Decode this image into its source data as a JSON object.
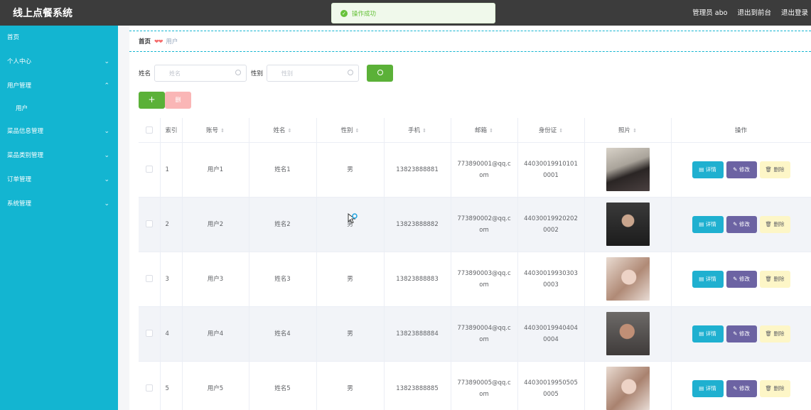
{
  "app": {
    "title": "线上点餐系统"
  },
  "toast": {
    "message": "操作成功"
  },
  "header": {
    "admin_label": "管理员 abo",
    "to_front": "退出到前台",
    "logout": "退出登录"
  },
  "sidebar": {
    "items": [
      {
        "label": "首页"
      },
      {
        "label": "个人中心"
      },
      {
        "label": "用户管理"
      },
      {
        "label": "菜品信息管理"
      },
      {
        "label": "菜品类别管理"
      },
      {
        "label": "订单管理"
      },
      {
        "label": "系统管理"
      }
    ],
    "sub_user": "用户"
  },
  "breadcrumb": {
    "home": "首页",
    "separator": "❤❤",
    "current": "用户"
  },
  "search": {
    "name_label": "姓名",
    "name_placeholder": "姓名",
    "gender_label": "性别",
    "gender_placeholder": "性别"
  },
  "actions": {
    "add": "+",
    "delete": "删"
  },
  "table": {
    "columns": [
      "",
      "索引",
      "账号",
      "姓名",
      "性别",
      "手机",
      "邮箱",
      "身份证",
      "照片",
      "操作"
    ],
    "rows": [
      {
        "index": "1",
        "account": "用户1",
        "name": "姓名1",
        "gender": "男",
        "phone": "13823888881",
        "email": "773890001@qq.com",
        "id_card": "440300199101010001"
      },
      {
        "index": "2",
        "account": "用户2",
        "name": "姓名2",
        "gender": "男",
        "phone": "13823888882",
        "email": "773890002@qq.com",
        "id_card": "440300199202020002"
      },
      {
        "index": "3",
        "account": "用户3",
        "name": "姓名3",
        "gender": "男",
        "phone": "13823888883",
        "email": "773890003@qq.com",
        "id_card": "440300199303030003"
      },
      {
        "index": "4",
        "account": "用户4",
        "name": "姓名4",
        "gender": "男",
        "phone": "13823888884",
        "email": "773890004@qq.com",
        "id_card": "440300199404040004"
      },
      {
        "index": "5",
        "account": "用户5",
        "name": "姓名5",
        "gender": "男",
        "phone": "13823888885",
        "email": "773890005@qq.com",
        "id_card": "440300199505050005"
      }
    ],
    "op_detail": "详情",
    "op_edit": "修改",
    "op_delete": "删除"
  },
  "colors": {
    "sidebar": "#13b5d1",
    "topbar": "#3c3c3c",
    "success": "#5bb138",
    "edit": "#6c63a3"
  }
}
